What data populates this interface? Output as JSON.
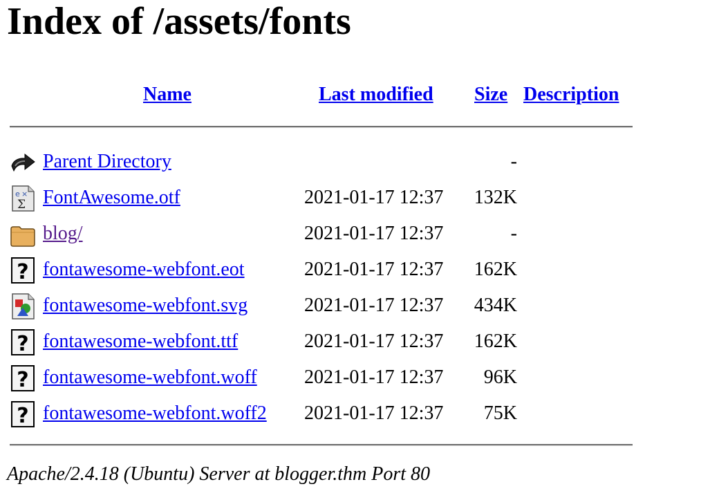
{
  "page_title": "Index of /assets/fonts",
  "columns": {
    "name": "Name",
    "last_modified": "Last modified",
    "size": "Size",
    "description": "Description"
  },
  "rows": [
    {
      "icon": "back-arrow-icon",
      "name": "Parent Directory",
      "date": "",
      "size": "-",
      "visited": false
    },
    {
      "icon": "font-file-icon",
      "name": "FontAwesome.otf",
      "date": "2021-01-17 12:37",
      "size": "132K",
      "visited": false
    },
    {
      "icon": "folder-icon",
      "name": "blog/",
      "date": "2021-01-17 12:37",
      "size": "-",
      "visited": true
    },
    {
      "icon": "unknown-file-icon",
      "name": "fontawesome-webfont.eot",
      "date": "2021-01-17 12:37",
      "size": "162K",
      "visited": false
    },
    {
      "icon": "image-file-icon",
      "name": "fontawesome-webfont.svg",
      "date": "2021-01-17 12:37",
      "size": "434K",
      "visited": false
    },
    {
      "icon": "unknown-file-icon",
      "name": "fontawesome-webfont.ttf",
      "date": "2021-01-17 12:37",
      "size": "162K",
      "visited": false
    },
    {
      "icon": "unknown-file-icon",
      "name": "fontawesome-webfont.woff",
      "date": "2021-01-17 12:37",
      "size": "96K",
      "visited": false
    },
    {
      "icon": "unknown-file-icon",
      "name": "fontawesome-webfont.woff2",
      "date": "2021-01-17 12:37",
      "size": "75K",
      "visited": false
    }
  ],
  "footer": "Apache/2.4.18 (Ubuntu) Server at blogger.thm Port 80",
  "colors": {
    "link": "#0000ee",
    "visited_link": "#551a8b",
    "rule": "#6f6f6f"
  }
}
